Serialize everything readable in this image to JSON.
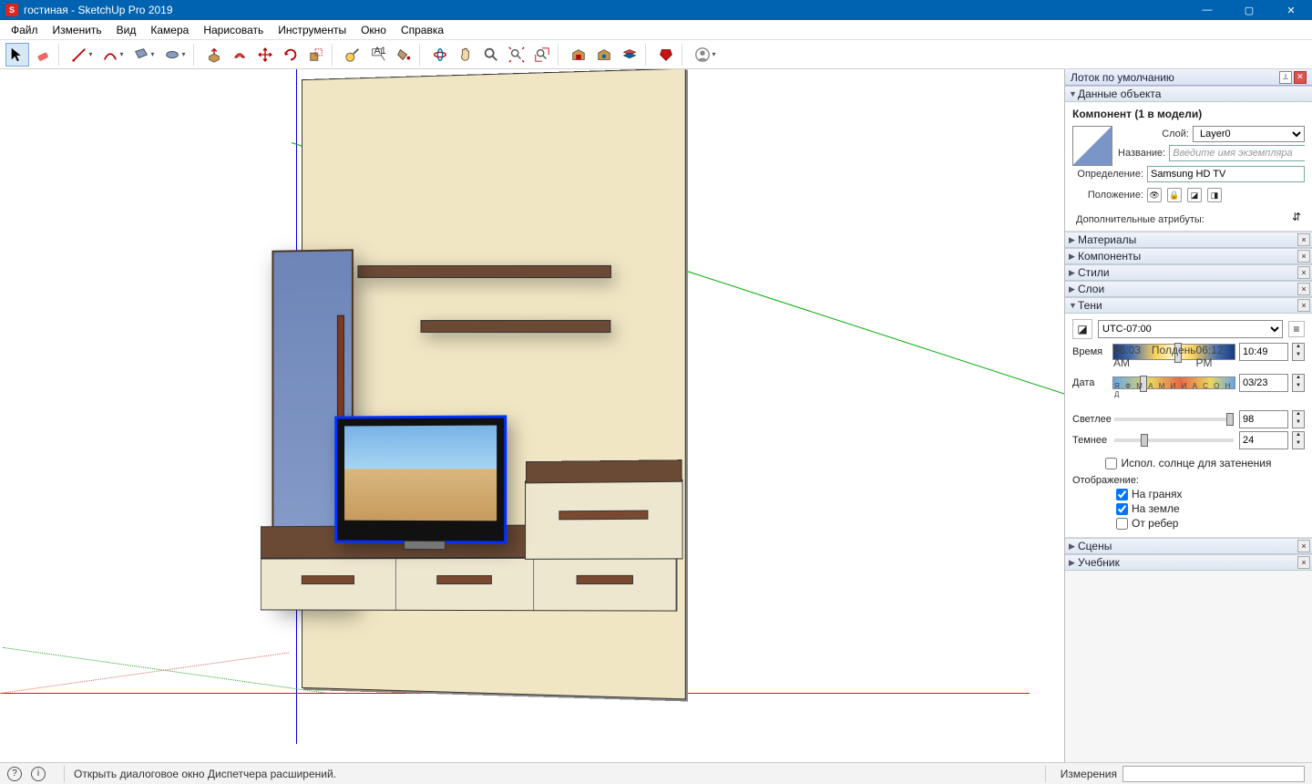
{
  "title": "гостиная - SketchUp Pro 2019",
  "menu": [
    "Файл",
    "Изменить",
    "Вид",
    "Камера",
    "Нарисовать",
    "Инструменты",
    "Окно",
    "Справка"
  ],
  "toolbar": [
    {
      "name": "select",
      "active": true,
      "drop": false
    },
    {
      "name": "eraser",
      "drop": false
    },
    {
      "name": "line",
      "drop": true
    },
    {
      "name": "arc",
      "drop": true
    },
    {
      "name": "rectangle",
      "drop": true
    },
    {
      "name": "circle",
      "drop": true
    },
    {
      "name": "pushpull"
    },
    {
      "name": "offset"
    },
    {
      "name": "move"
    },
    {
      "name": "rotate"
    },
    {
      "name": "scale"
    },
    {
      "name": "tape"
    },
    {
      "name": "text"
    },
    {
      "name": "paint"
    },
    {
      "name": "orbit"
    },
    {
      "name": "pan"
    },
    {
      "name": "zoom"
    },
    {
      "name": "zoom-extents"
    },
    {
      "name": "zoom-window"
    },
    {
      "name": "warehouse"
    },
    {
      "name": "ext-warehouse"
    },
    {
      "name": "layers"
    },
    {
      "name": "ruby"
    },
    {
      "name": "user"
    }
  ],
  "tray": {
    "title": "Лоток по умолчанию",
    "entity": {
      "head": "Данные объекта",
      "component_label": "Компонент (1 в модели)",
      "layer_label": "Слой:",
      "layer_value": "Layer0",
      "name_label": "Название:",
      "name_placeholder": "Введите имя экземпляра",
      "definition_label": "Определение:",
      "definition_value": "Samsung HD TV",
      "position_label": "Положение:",
      "extra_attrs": "Дополнительные атрибуты:"
    },
    "collapsed": [
      "Материалы",
      "Компоненты",
      "Стили",
      "Слои"
    ],
    "shadows": {
      "head": "Тени",
      "tz": "UTC-07:00",
      "time_label": "Время",
      "time_start": "06:03 AM",
      "time_noon": "Полдень",
      "time_end": "06:12 PM",
      "time_value": "10:49",
      "date_label": "Дата",
      "months": "Я Ф М А М И И А С О Н Д",
      "date_value": "03/23",
      "light_label": "Светлее",
      "light_value": "98",
      "dark_label": "Темнее",
      "dark_value": "24",
      "sun_shading": "Испол. солнце для затенения",
      "display_label": "Отображение:",
      "on_faces": "На гранях",
      "on_ground": "На земле",
      "from_edges": "От ребер"
    },
    "bottom": [
      "Сцены",
      "Учебник"
    ]
  },
  "statusbar": {
    "text": "Открыть диалоговое окно Диспетчера расширений.",
    "measure_label": "Измерения"
  }
}
